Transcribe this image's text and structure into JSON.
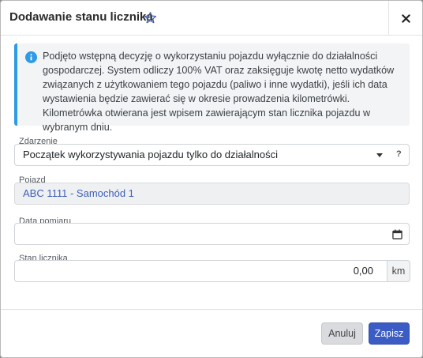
{
  "dialog": {
    "title": "Dodawanie stanu licznika"
  },
  "info": {
    "text": "Podjęto wstępną decyzję o wykorzystaniu pojazdu wyłącznie do działalności gospodarczej. System odliczy 100% VAT oraz zaksięguje kwotę netto wydatków związanych z użytkowaniem tego pojazdu (paliwo i inne wydatki), jeśli ich data wystawienia będzie zawierać się w okresie prowadzenia kilometrówki. Kilometrówka otwierana jest wpisem zawierającym stan licznika pojazdu w wybranym dniu."
  },
  "fields": {
    "event": {
      "label": "Zdarzenie",
      "value": "Początek wykorzystywania pojazdu tylko do działalności",
      "help": "?"
    },
    "vehicle": {
      "label": "Pojazd",
      "value": "ABC 1111 - Samochód 1"
    },
    "date": {
      "label": "Data pomiaru",
      "value": ""
    },
    "odometer": {
      "label": "Stan licznika",
      "value": "0,00",
      "unit": "km"
    }
  },
  "footer": {
    "cancel_label": "Anuluj",
    "save_label": "Zapisz"
  },
  "colors": {
    "accent": "#3a5cc4",
    "info_border": "#2f9ae6",
    "link": "#3f5fb8"
  }
}
